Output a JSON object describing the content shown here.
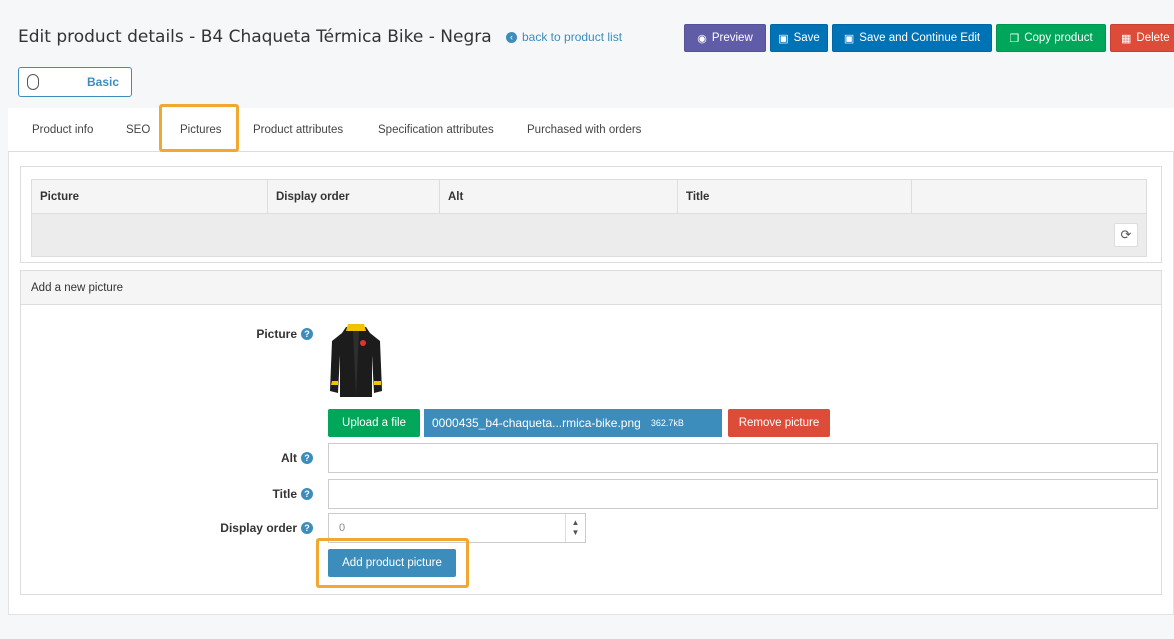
{
  "header": {
    "title": "Edit product details - B4 Chaqueta Térmica Bike - Negra",
    "back_link": "back to product list"
  },
  "toolbar": {
    "preview": "Preview",
    "save": "Save",
    "save_continue": "Save and Continue Edit",
    "copy": "Copy product",
    "delete": "Delete"
  },
  "mode_toggle": {
    "label": "Basic"
  },
  "tabs": [
    {
      "label": "Product info"
    },
    {
      "label": "SEO"
    },
    {
      "label": "Pictures"
    },
    {
      "label": "Product attributes"
    },
    {
      "label": "Specification attributes"
    },
    {
      "label": "Purchased with orders"
    }
  ],
  "pictures_table": {
    "columns": [
      "Picture",
      "Display order",
      "Alt",
      "Title",
      ""
    ]
  },
  "add_picture": {
    "section_title": "Add a new picture",
    "picture_label": "Picture",
    "upload_button": "Upload a file",
    "file_name": "0000435_b4-chaqueta...rmica-bike.png",
    "file_size": "362.7kB",
    "remove_button": "Remove picture",
    "alt_label": "Alt",
    "title_label": "Title",
    "display_order_label": "Display order",
    "display_order_value": "0",
    "add_button": "Add product picture"
  },
  "colors": {
    "primary": "#3c8dbc",
    "success": "#00a65a",
    "danger": "#dd4b39",
    "purple": "#605ca8",
    "highlight": "#f0a830"
  }
}
